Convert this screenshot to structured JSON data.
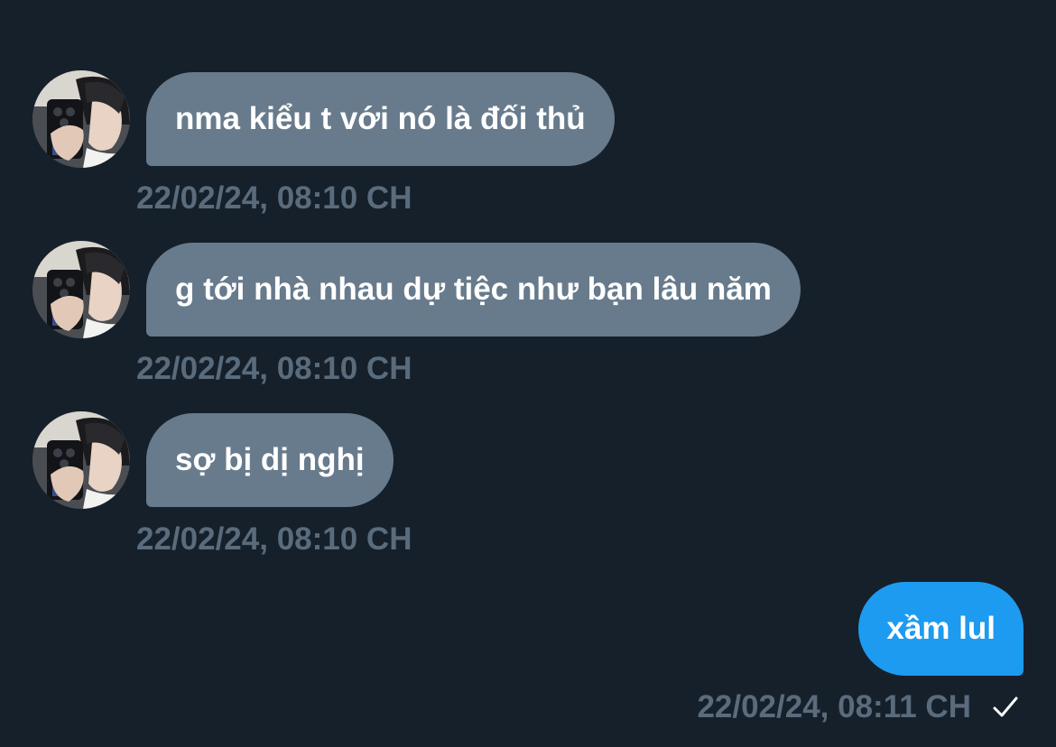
{
  "messages": [
    {
      "direction": "incoming",
      "text": "nma kiểu t với nó là đối thủ",
      "timestamp": "22/02/24, 08:10 CH"
    },
    {
      "direction": "incoming",
      "text": "g tới nhà nhau dự tiệc như bạn lâu năm",
      "timestamp": "22/02/24, 08:10 CH"
    },
    {
      "direction": "incoming",
      "text": "sợ bị dị nghị",
      "timestamp": "22/02/24, 08:10 CH"
    },
    {
      "direction": "outgoing",
      "text": "xầm lul",
      "timestamp": "22/02/24, 08:11 CH",
      "status_icon": "check-icon"
    }
  ],
  "colors": {
    "background": "#15202b",
    "incoming_bubble": "#687b8c",
    "outgoing_bubble": "#1d9bf0",
    "timestamp": "#5a6b7c",
    "message_text": "#ffffff"
  }
}
